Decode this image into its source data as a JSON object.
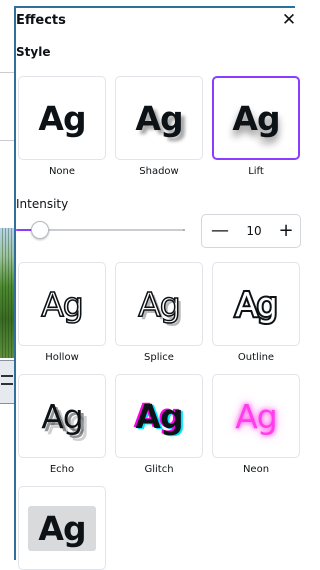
{
  "panel": {
    "title": "Effects",
    "close_symbol": "✕"
  },
  "style_section": {
    "title": "Style",
    "presets": [
      {
        "label": "None",
        "preview": "Ag",
        "selected": false
      },
      {
        "label": "Shadow",
        "preview": "Ag",
        "selected": false
      },
      {
        "label": "Lift",
        "preview": "Ag",
        "selected": true
      },
      {
        "label": "Hollow",
        "preview": "Ag",
        "selected": false
      },
      {
        "label": "Splice",
        "preview": "Ag",
        "selected": false
      },
      {
        "label": "Outline",
        "preview": "Ag",
        "selected": false
      },
      {
        "label": "Echo",
        "preview": "Ag",
        "selected": false
      },
      {
        "label": "Glitch",
        "preview": "Ag",
        "selected": false
      },
      {
        "label": "Neon",
        "preview": "Ag",
        "selected": false
      },
      {
        "preview": "Ag",
        "selected": false
      }
    ]
  },
  "intensity": {
    "label": "Intensity",
    "value": "10",
    "fraction": 0.1,
    "minus_symbol": "—",
    "plus_symbol": "+"
  },
  "colors": {
    "accent": "#8b3dff",
    "text": "#0d1216",
    "border": "#e1e4e8"
  }
}
